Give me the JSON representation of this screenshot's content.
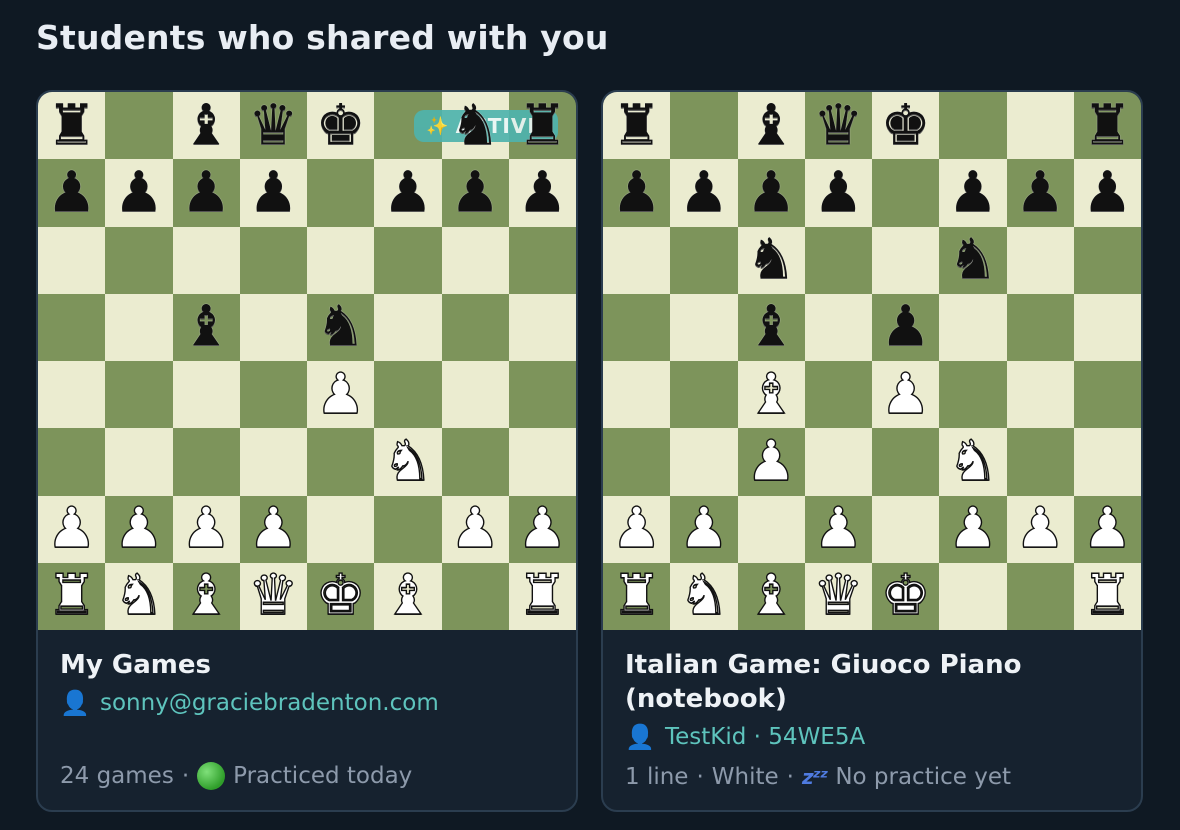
{
  "section": {
    "title": "Students who shared with you"
  },
  "colors": {
    "light_square": "#ebecd0",
    "dark_square": "#7d945b",
    "badge": "#4fb3ad",
    "link": "#5ec4bd"
  },
  "cards": [
    {
      "title": "My Games",
      "owner": "sonny@graciebradenton.com",
      "owner_icon": "person-icon",
      "badge": {
        "icon": "sparkles-icon",
        "text": "ACTIVE"
      },
      "meta": {
        "count": "24 games",
        "sep": "·",
        "status_icon": "green-circle-icon",
        "status": "Practiced today"
      },
      "board": [
        [
          "r",
          "",
          "b",
          "q",
          "k",
          "",
          "n",
          "r"
        ],
        [
          "p",
          "p",
          "p",
          "p",
          "",
          "p",
          "p",
          "p"
        ],
        [
          "",
          "",
          "",
          "",
          "",
          "",
          "",
          ""
        ],
        [
          "",
          "",
          "b",
          "",
          "n",
          "",
          "",
          ""
        ],
        [
          "",
          "",
          "",
          "",
          "P",
          "",
          "",
          ""
        ],
        [
          "",
          "",
          "",
          "",
          "",
          "N",
          "",
          ""
        ],
        [
          "P",
          "P",
          "P",
          "P",
          "",
          "",
          "P",
          "P"
        ],
        [
          "R",
          "N",
          "B",
          "Q",
          "K",
          "B",
          "",
          "R"
        ]
      ]
    },
    {
      "title": "Italian Game: Giuoco Piano (notebook)",
      "owner": "TestKid · 54WE5A",
      "owner_icon": "person-icon",
      "meta": {
        "count": "1 line",
        "sep": "·",
        "color": "White",
        "status_icon": "zzz-icon",
        "status": "No practice yet"
      },
      "board": [
        [
          "r",
          "",
          "b",
          "q",
          "k",
          "",
          "",
          "r"
        ],
        [
          "p",
          "p",
          "p",
          "p",
          "",
          "p",
          "p",
          "p"
        ],
        [
          "",
          "",
          "n",
          "",
          "",
          "n",
          "",
          ""
        ],
        [
          "",
          "",
          "b",
          "",
          "p",
          "",
          "",
          ""
        ],
        [
          "",
          "",
          "B",
          "",
          "P",
          "",
          "",
          ""
        ],
        [
          "",
          "",
          "P",
          "",
          "",
          "N",
          "",
          ""
        ],
        [
          "P",
          "P",
          "",
          "P",
          "",
          "P",
          "P",
          "P"
        ],
        [
          "R",
          "N",
          "B",
          "Q",
          "K",
          "",
          "",
          "R"
        ]
      ]
    }
  ]
}
